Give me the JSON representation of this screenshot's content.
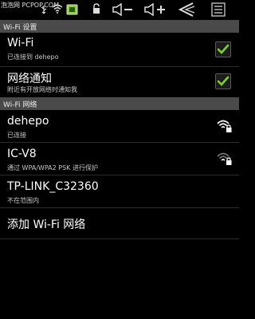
{
  "status_bar": {
    "watermark": "泡泡网 PCPOP.COM",
    "icons": [
      "usb-icon",
      "wifi-signal-icon",
      "battery-icon",
      "lock-icon",
      "volume-down-icon",
      "volume-up-icon",
      "back-icon",
      "menu-icon"
    ]
  },
  "sections": {
    "wifi_settings": "Wi-Fi 设置",
    "wifi_networks": "Wi-Fi 网络"
  },
  "settings": [
    {
      "title": "Wi-Fi",
      "subtitle": "已连接到 dehepo",
      "checked": true
    },
    {
      "title": "网络通知",
      "subtitle": "附近有开放网络时通知我",
      "checked": true
    }
  ],
  "networks": [
    {
      "ssid": "dehepo",
      "status": "已连接",
      "secured": true
    },
    {
      "ssid": "IC-V8",
      "status": "通过 WPA/WPA2 PSK 进行保护",
      "secured": true
    },
    {
      "ssid": "TP-LINK_C32360",
      "status": "不在范围内",
      "secured": false
    }
  ],
  "add_network": "添加 Wi-Fi 网络",
  "colors": {
    "background": "#000000",
    "section_header": "#4a4a4a",
    "checkmark": "#7ed321"
  }
}
